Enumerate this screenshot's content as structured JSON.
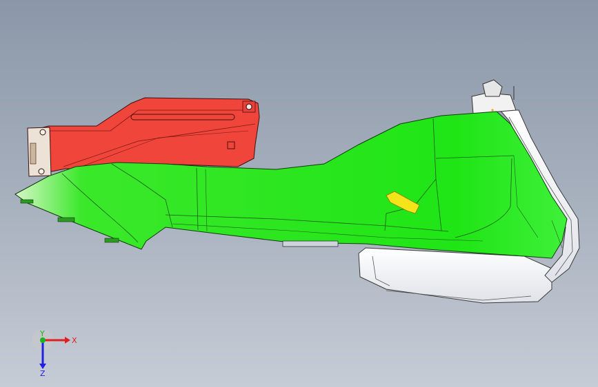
{
  "viewport": {
    "background_top": "#8b97a8",
    "background_bottom": "#c6ccd6"
  },
  "parts": [
    {
      "name": "red-bracket-part",
      "color": "#f0453a"
    },
    {
      "name": "green-panel-part",
      "color": "#22e81c"
    },
    {
      "name": "white-trim-part",
      "color": "#f4f5f7"
    },
    {
      "name": "yellow-clip-part",
      "color": "#f6e41a"
    }
  ],
  "triad": {
    "x_label": "X",
    "y_label": "Y",
    "z_label": "Z",
    "x_color": "#e02020",
    "y_color": "#20b020",
    "z_color": "#2020e0"
  }
}
